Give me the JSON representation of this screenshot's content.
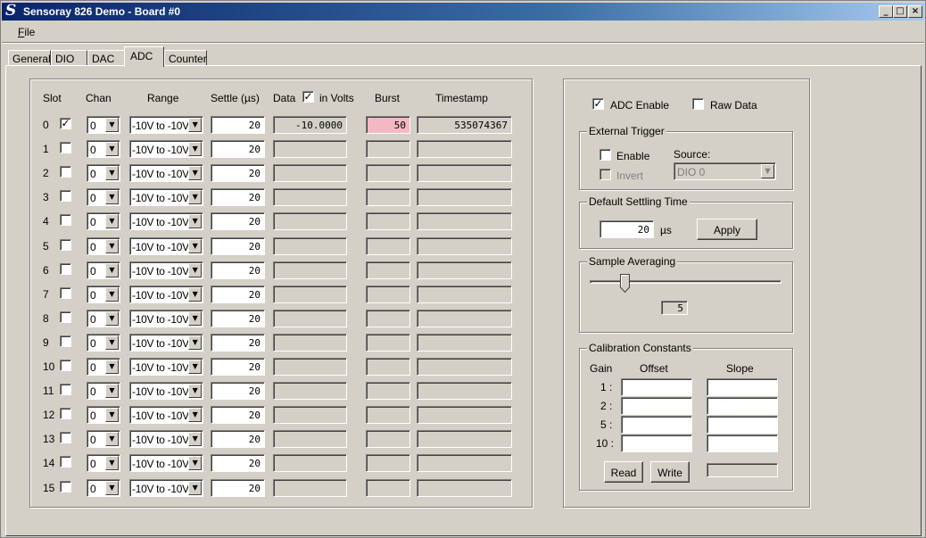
{
  "window": {
    "title": "Sensoray 826 Demo - Board #0"
  },
  "menu": {
    "file_accel": "F",
    "file_rest": "ile"
  },
  "tabs": [
    "General",
    "DIO",
    "DAC",
    "ADC",
    "Counter"
  ],
  "adc_table": {
    "headers": {
      "slot": "Slot",
      "chan": "Chan",
      "range": "Range",
      "settle": "Settle (µs)",
      "data": "Data",
      "in_volts": "in Volts",
      "burst": "Burst",
      "timestamp": "Timestamp"
    },
    "in_volts_checked": true,
    "rows": [
      {
        "slot": "0",
        "enabled": true,
        "chan": "0",
        "range": "-10V to -10V",
        "settle": "20",
        "data": "-10.0000",
        "burst": "50",
        "timestamp": "535074367"
      },
      {
        "slot": "1",
        "enabled": false,
        "chan": "0",
        "range": "-10V to -10V",
        "settle": "20",
        "data": "",
        "burst": "",
        "timestamp": ""
      },
      {
        "slot": "2",
        "enabled": false,
        "chan": "0",
        "range": "-10V to -10V",
        "settle": "20",
        "data": "",
        "burst": "",
        "timestamp": ""
      },
      {
        "slot": "3",
        "enabled": false,
        "chan": "0",
        "range": "-10V to -10V",
        "settle": "20",
        "data": "",
        "burst": "",
        "timestamp": ""
      },
      {
        "slot": "4",
        "enabled": false,
        "chan": "0",
        "range": "-10V to -10V",
        "settle": "20",
        "data": "",
        "burst": "",
        "timestamp": ""
      },
      {
        "slot": "5",
        "enabled": false,
        "chan": "0",
        "range": "-10V to -10V",
        "settle": "20",
        "data": "",
        "burst": "",
        "timestamp": ""
      },
      {
        "slot": "6",
        "enabled": false,
        "chan": "0",
        "range": "-10V to -10V",
        "settle": "20",
        "data": "",
        "burst": "",
        "timestamp": ""
      },
      {
        "slot": "7",
        "enabled": false,
        "chan": "0",
        "range": "-10V to -10V",
        "settle": "20",
        "data": "",
        "burst": "",
        "timestamp": ""
      },
      {
        "slot": "8",
        "enabled": false,
        "chan": "0",
        "range": "-10V to -10V",
        "settle": "20",
        "data": "",
        "burst": "",
        "timestamp": ""
      },
      {
        "slot": "9",
        "enabled": false,
        "chan": "0",
        "range": "-10V to -10V",
        "settle": "20",
        "data": "",
        "burst": "",
        "timestamp": ""
      },
      {
        "slot": "10",
        "enabled": false,
        "chan": "0",
        "range": "-10V to -10V",
        "settle": "20",
        "data": "",
        "burst": "",
        "timestamp": ""
      },
      {
        "slot": "11",
        "enabled": false,
        "chan": "0",
        "range": "-10V to -10V",
        "settle": "20",
        "data": "",
        "burst": "",
        "timestamp": ""
      },
      {
        "slot": "12",
        "enabled": false,
        "chan": "0",
        "range": "-10V to -10V",
        "settle": "20",
        "data": "",
        "burst": "",
        "timestamp": ""
      },
      {
        "slot": "13",
        "enabled": false,
        "chan": "0",
        "range": "-10V to -10V",
        "settle": "20",
        "data": "",
        "burst": "",
        "timestamp": ""
      },
      {
        "slot": "14",
        "enabled": false,
        "chan": "0",
        "range": "-10V to -10V",
        "settle": "20",
        "data": "",
        "burst": "",
        "timestamp": ""
      },
      {
        "slot": "15",
        "enabled": false,
        "chan": "0",
        "range": "-10V to -10V",
        "settle": "20",
        "data": "",
        "burst": "",
        "timestamp": ""
      }
    ]
  },
  "options": {
    "adc_enable_label": "ADC Enable",
    "adc_enable_checked": true,
    "raw_data_label": "Raw Data",
    "raw_data_checked": false
  },
  "external_trigger": {
    "title": "External Trigger",
    "enable_label": "Enable",
    "enable_checked": false,
    "invert_label": "Invert",
    "invert_checked": false,
    "source_label": "Source:",
    "source_value": "DIO  0"
  },
  "default_settling": {
    "title": "Default Settling Time",
    "value": "20",
    "unit": "µs",
    "apply_label": "Apply"
  },
  "sample_averaging": {
    "title": "Sample Averaging",
    "value": "5",
    "slider_fraction": 0.15
  },
  "calibration": {
    "title": "Calibration Constants",
    "gain_header": "Gain",
    "offset_header": "Offset",
    "slope_header": "Slope",
    "gains": [
      "1 :",
      "2 :",
      "5 :",
      "10 :"
    ],
    "read_label": "Read",
    "write_label": "Write"
  },
  "colors": {
    "title_start": "#0a246a",
    "title_end": "#a6caf0",
    "burst_highlight": "#f4b8c4",
    "face": "#d4d0c8"
  },
  "icons": {
    "app": "sensoray-s-icon",
    "minimize": "minimize-icon",
    "maximize": "maximize-icon",
    "close": "close-icon",
    "dropdown": "chevron-down-icon"
  }
}
